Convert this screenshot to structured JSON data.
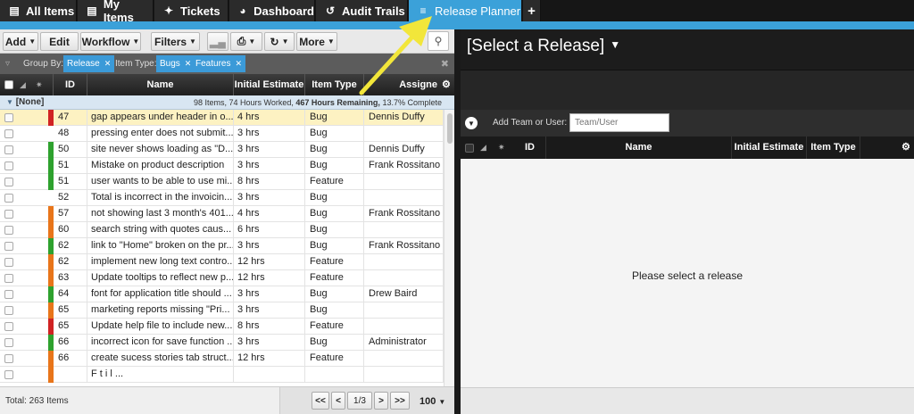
{
  "tabs": [
    {
      "label": "All Items",
      "icon": "list-icon"
    },
    {
      "label": "My Items",
      "icon": "list-icon"
    },
    {
      "label": "Tickets",
      "icon": "ticket-icon"
    },
    {
      "label": "Dashboard",
      "icon": "dashboard-icon"
    },
    {
      "label": "Audit Trails",
      "icon": "history-icon"
    },
    {
      "label": "Release Planner",
      "icon": "sliders-icon",
      "active": true
    }
  ],
  "add_tab": "+",
  "toolbar": {
    "add": "Add",
    "edit": "Edit",
    "workflow": "Workflow",
    "filters": "Filters",
    "more": "More"
  },
  "groupbar": {
    "group_by_label": "Group By:",
    "group_by_chip": "Release",
    "item_type_label": "Item Type:",
    "item_type_chips": [
      "Bugs",
      "Features"
    ]
  },
  "columns": {
    "id": "ID",
    "name": "Name",
    "estimate": "Initial Estimate",
    "type": "Item Type",
    "assignee": "Assigne"
  },
  "group": {
    "name": "[None]",
    "summary_pre": "98 Items, 74 Hours Worked,",
    "summary_bold": "467 Hours Remaining,",
    "summary_post": "13.7% Complete"
  },
  "rows": [
    {
      "id": "47",
      "name": "gap appears under header in o...",
      "estimate": "4 hrs",
      "type": "Bug",
      "assignee": "Dennis Duffy",
      "priority": "#d02323",
      "selected": true
    },
    {
      "id": "48",
      "name": "pressing enter does not submit...",
      "estimate": "3 hrs",
      "type": "Bug",
      "assignee": "",
      "priority": ""
    },
    {
      "id": "50",
      "name": "site never shows loading as \"D...",
      "estimate": "3 hrs",
      "type": "Bug",
      "assignee": "Dennis Duffy",
      "priority": "#2ea12e"
    },
    {
      "id": "51",
      "name": "Mistake on product description",
      "estimate": "3 hrs",
      "type": "Bug",
      "assignee": "Frank Rossitano",
      "priority": "#2ea12e"
    },
    {
      "id": "51",
      "name": "user wants to be able to use mi...",
      "estimate": "8 hrs",
      "type": "Feature",
      "assignee": "",
      "priority": "#2ea12e"
    },
    {
      "id": "52",
      "name": "Total is incorrect in the invoicin...",
      "estimate": "3 hrs",
      "type": "Bug",
      "assignee": "",
      "priority": ""
    },
    {
      "id": "57",
      "name": "not showing last 3 month's 401...",
      "estimate": "4 hrs",
      "type": "Bug",
      "assignee": "Frank Rossitano",
      "priority": "#e8751a"
    },
    {
      "id": "60",
      "name": "search string with quotes caus...",
      "estimate": "6 hrs",
      "type": "Bug",
      "assignee": "",
      "priority": "#e8751a"
    },
    {
      "id": "62",
      "name": "link to \"Home\" broken on the pr...",
      "estimate": "3 hrs",
      "type": "Bug",
      "assignee": "Frank Rossitano",
      "priority": "#2ea12e"
    },
    {
      "id": "62",
      "name": "implement new long text contro...",
      "estimate": "12 hrs",
      "type": "Feature",
      "assignee": "",
      "priority": "#e8751a"
    },
    {
      "id": "63",
      "name": "Update tooltips to reflect new p...",
      "estimate": "12 hrs",
      "type": "Feature",
      "assignee": "",
      "priority": "#e8751a"
    },
    {
      "id": "64",
      "name": "font for application title should ...",
      "estimate": "3 hrs",
      "type": "Bug",
      "assignee": "Drew Baird",
      "priority": "#2ea12e"
    },
    {
      "id": "65",
      "name": "marketing reports missing \"Pri...",
      "estimate": "3 hrs",
      "type": "Bug",
      "assignee": "",
      "priority": "#e8751a"
    },
    {
      "id": "65",
      "name": "Update help file to include new...",
      "estimate": "8 hrs",
      "type": "Feature",
      "assignee": "",
      "priority": "#d02323"
    },
    {
      "id": "66",
      "name": "incorrect icon for save function ...",
      "estimate": "3 hrs",
      "type": "Bug",
      "assignee": "Administrator",
      "priority": "#2ea12e"
    },
    {
      "id": "66",
      "name": "create sucess stories tab struct...",
      "estimate": "12 hrs",
      "type": "Feature",
      "assignee": "",
      "priority": "#e8751a"
    },
    {
      "id": "",
      "name": "F   t   i   l   ...",
      "estimate": "",
      "type": "",
      "assignee": "",
      "priority": "#e8751a"
    }
  ],
  "footer": {
    "total": "Total: 263 Items",
    "first": "<<",
    "prev": "<",
    "page": "1/3",
    "next": ">",
    "last": ">>",
    "page_size": "100"
  },
  "right": {
    "release_select": "[Select a Release]",
    "add_team_label": "Add Team or User:",
    "team_placeholder": "Team/User",
    "columns": {
      "id": "ID",
      "name": "Name",
      "estimate": "Initial Estimate",
      "type": "Item Type"
    },
    "empty_message": "Please select a release"
  },
  "colors": {
    "accent": "#3ba1d9",
    "priority_high": "#d02323",
    "priority_medium": "#e8751a",
    "priority_low": "#2ea12e",
    "selected_row": "#fdf2c2",
    "annotation_arrow": "#f2e63a"
  }
}
